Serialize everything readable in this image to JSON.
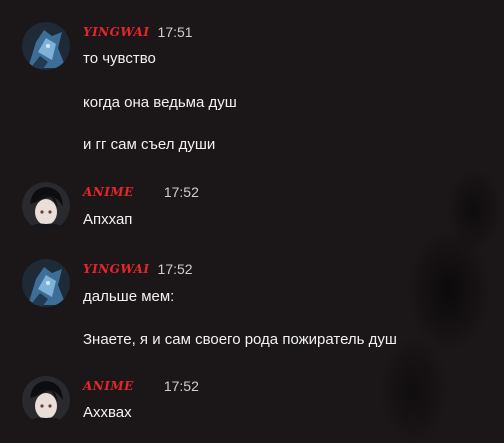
{
  "messages": [
    {
      "author": "YINGWAI",
      "time": "17:51",
      "avatar": "dark-blue-character-avatar",
      "lines": [
        "то чувство",
        "когда она ведьма душ",
        "и гг сам съел души"
      ]
    },
    {
      "author": "ANIME",
      "time": "17:52",
      "avatar": "anime-boy-avatar",
      "lines": [
        "Апххап"
      ]
    },
    {
      "author": "YINGWAI",
      "time": "17:52",
      "avatar": "dark-blue-character-avatar",
      "lines": [
        "дальше мем:",
        "Знаете, я и сам своего рода пожиратель душ"
      ]
    },
    {
      "author": "ANIME",
      "time": "17:52",
      "avatar": "anime-boy-avatar",
      "lines": [
        "Аххвах"
      ]
    }
  ],
  "colors": {
    "background": "#1b1618",
    "author_name": "#e5262b",
    "timestamp": "#cfcfcf",
    "message_text": "#f2f2f2"
  }
}
